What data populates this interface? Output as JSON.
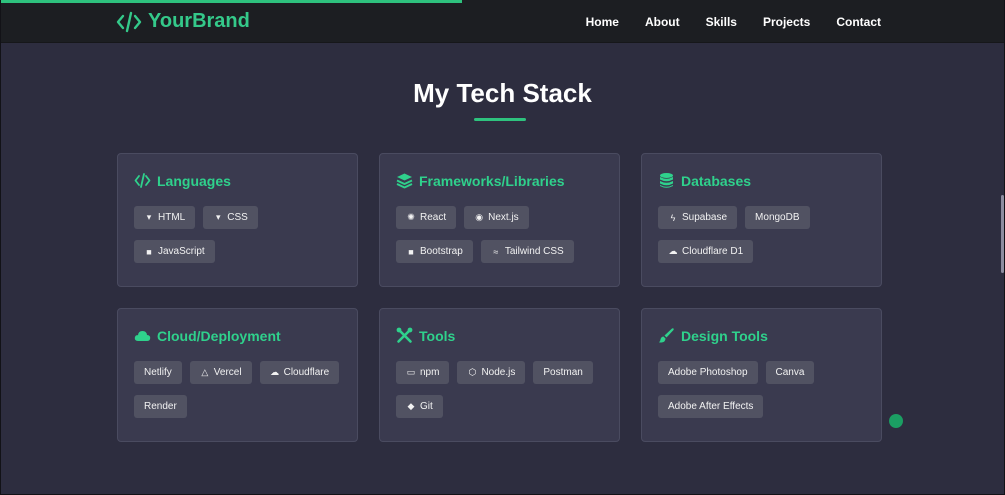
{
  "brand": {
    "name": "YourBrand",
    "icon": "code-icon",
    "color": "#34c98a"
  },
  "scroll_progress": 0.46,
  "nav": {
    "items": [
      {
        "label": "Home"
      },
      {
        "label": "About"
      },
      {
        "label": "Skills"
      },
      {
        "label": "Projects"
      },
      {
        "label": "Contact"
      }
    ]
  },
  "section": {
    "title": "My Tech Stack",
    "accent": "#2ec27e"
  },
  "cards": [
    {
      "title": "Languages",
      "icon": "code-icon",
      "chips": [
        {
          "label": "HTML",
          "icon": "html5-icon",
          "glyph": "▾"
        },
        {
          "label": "CSS",
          "icon": "css3-icon",
          "glyph": "▾"
        },
        {
          "label": "JavaScript",
          "icon": "js-icon",
          "glyph": "■"
        }
      ]
    },
    {
      "title": "Frameworks/Libraries",
      "icon": "layers-icon",
      "chips": [
        {
          "label": "React",
          "icon": "react-icon",
          "glyph": "✺"
        },
        {
          "label": "Next.js",
          "icon": "nextjs-icon",
          "glyph": "◉"
        },
        {
          "label": "Bootstrap",
          "icon": "bootstrap-icon",
          "glyph": "■"
        },
        {
          "label": "Tailwind CSS",
          "icon": "tailwind-icon",
          "glyph": "≈"
        }
      ]
    },
    {
      "title": "Databases",
      "icon": "database-icon",
      "chips": [
        {
          "label": "Supabase",
          "icon": "bolt-icon",
          "glyph": "ϟ"
        },
        {
          "label": "MongoDB",
          "icon": "",
          "glyph": ""
        },
        {
          "label": "Cloudflare D1",
          "icon": "cloud-icon",
          "glyph": "☁"
        }
      ]
    },
    {
      "title": "Cloud/Deployment",
      "icon": "cloud-icon",
      "chips": [
        {
          "label": "Netlify",
          "icon": "",
          "glyph": ""
        },
        {
          "label": "Vercel",
          "icon": "triangle-icon",
          "glyph": "△"
        },
        {
          "label": "Cloudflare",
          "icon": "cloud-icon",
          "glyph": "☁"
        },
        {
          "label": "Render",
          "icon": "",
          "glyph": ""
        }
      ]
    },
    {
      "title": "Tools",
      "icon": "tools-icon",
      "chips": [
        {
          "label": "npm",
          "icon": "npm-icon",
          "glyph": "▭"
        },
        {
          "label": "Node.js",
          "icon": "nodejs-icon",
          "glyph": "⬡"
        },
        {
          "label": "Postman",
          "icon": "",
          "glyph": ""
        },
        {
          "label": "Git",
          "icon": "git-icon",
          "glyph": "◆"
        }
      ]
    },
    {
      "title": "Design Tools",
      "icon": "brush-icon",
      "chips": [
        {
          "label": "Adobe Photoshop",
          "icon": "",
          "glyph": ""
        },
        {
          "label": "Canva",
          "icon": "",
          "glyph": ""
        },
        {
          "label": "Adobe After Effects",
          "icon": "",
          "glyph": ""
        }
      ]
    }
  ]
}
